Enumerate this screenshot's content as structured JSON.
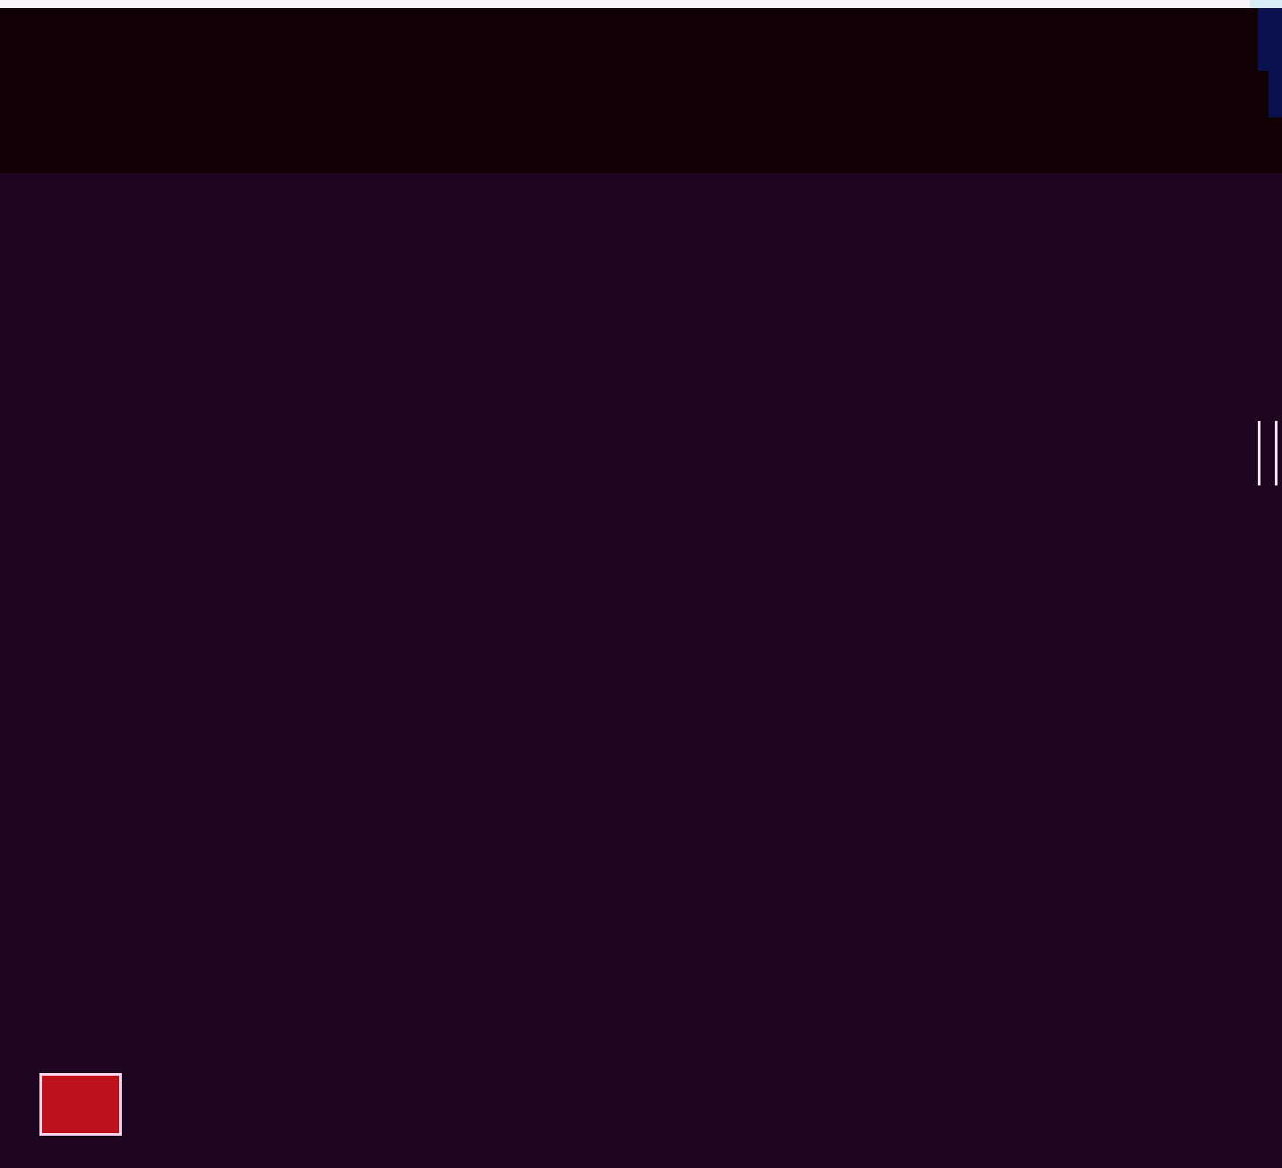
{
  "header": {
    "line1": "",
    "line2": "",
    "line3": "",
    "line4": ""
  },
  "body": {
    "line1": "",
    "line2": "",
    "line3": "",
    "line4": "",
    "line5": "",
    "line6": "",
    "line7": "",
    "line8": "",
    "line9": "",
    "line10": "",
    "line11": "",
    "line12": "",
    "line13": "",
    "line14": ""
  },
  "footer": {
    "large_line": "",
    "id_line": "",
    "logo_mark": "",
    "logo_wordmark": "",
    "note": ""
  },
  "colors": {
    "background": "#1e0520",
    "header_background": "#120105",
    "text": "#f2e6f0",
    "logo_red": "#c0121c",
    "logo_blue": "#0d1a6e",
    "scroll_indicator": "#0b1250"
  }
}
